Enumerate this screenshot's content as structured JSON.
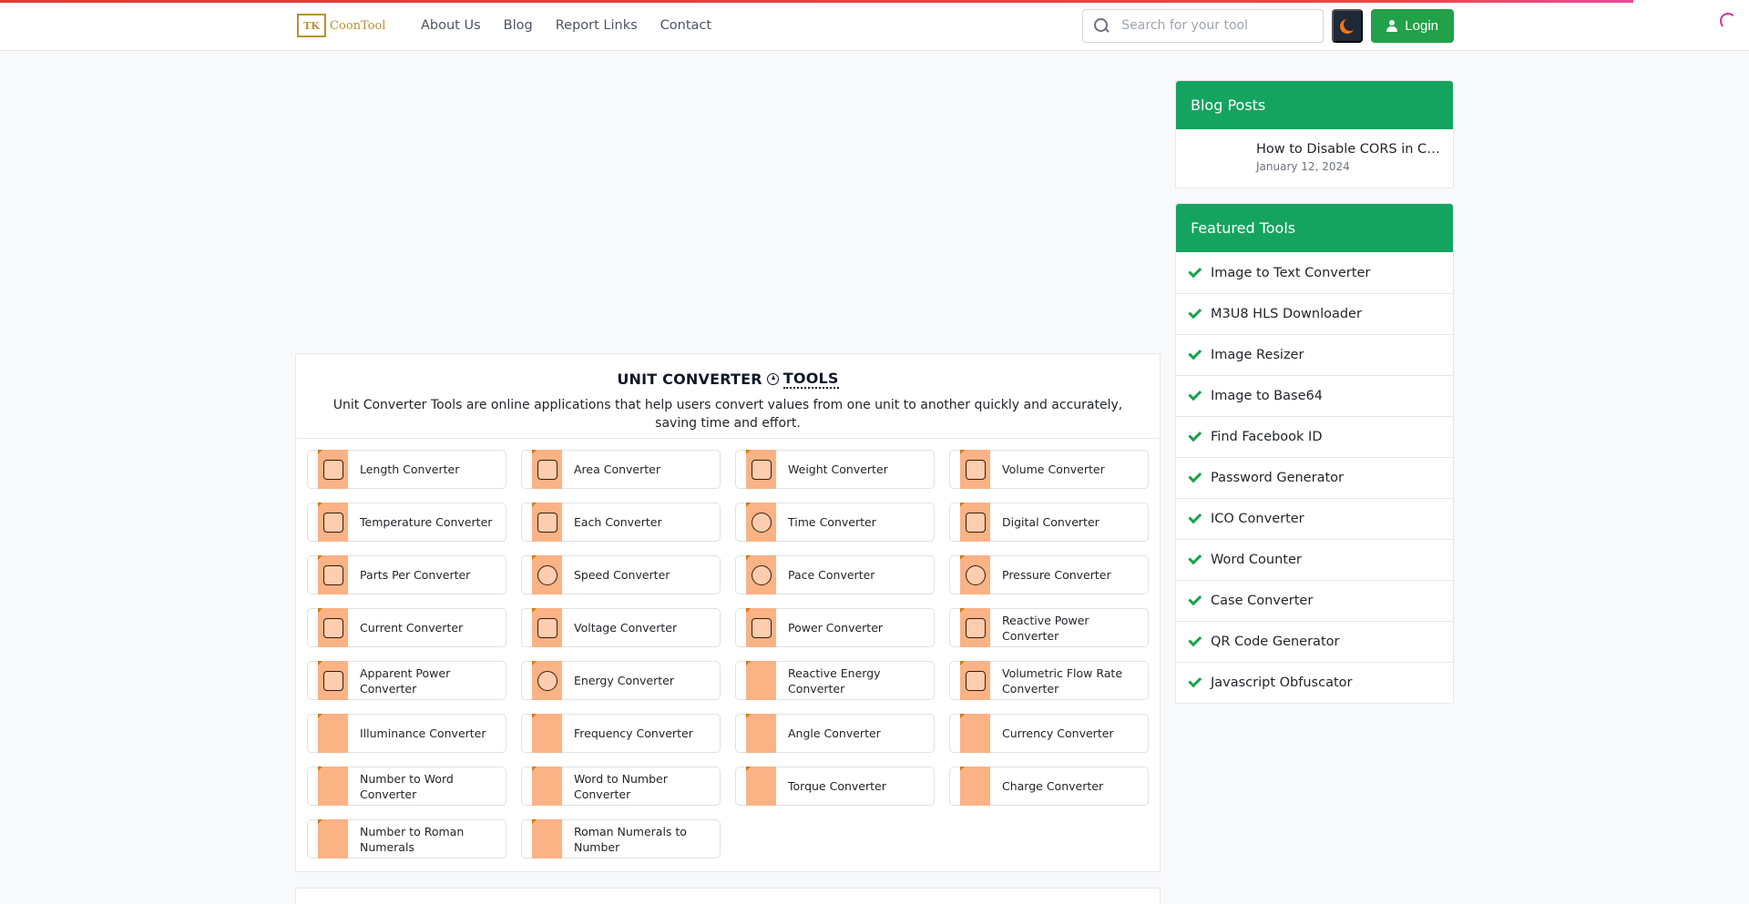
{
  "nav": {
    "logo_mark": "TK",
    "logo_text": "CoonTool",
    "links": [
      "About Us",
      "Blog",
      "Report Links",
      "Contact"
    ],
    "search_placeholder": "Search for your tool",
    "login_label": "Login"
  },
  "colors": {
    "accent_green": "#15a460",
    "login_green": "#22a14a",
    "progress_red": "#ef4444",
    "tool_icon_bg": "#fbb285"
  },
  "tools_section": {
    "title_part1": "UNIT CONVERTER",
    "title_part2": "TOOLS",
    "title_icon": "arrow-circle-up-icon",
    "description": "Unit Converter Tools are online applications that help users convert values from one unit to another quickly and accurately, saving time and effort.",
    "tools": [
      {
        "label": "Length Converter",
        "icon": "tape-measure-icon"
      },
      {
        "label": "Area Converter",
        "icon": "area-icon"
      },
      {
        "label": "Weight Converter",
        "icon": "scale-icon"
      },
      {
        "label": "Volume Converter",
        "icon": "speaker-icon"
      },
      {
        "label": "Temperature Converter",
        "icon": "thermometer-icon"
      },
      {
        "label": "Each Converter",
        "icon": "grid-icon"
      },
      {
        "label": "Time Converter",
        "icon": "clock-icon"
      },
      {
        "label": "Digital Converter",
        "icon": "chip-icon"
      },
      {
        "label": "Parts Per Converter",
        "icon": "parts-icon"
      },
      {
        "label": "Speed Converter",
        "icon": "speedometer-icon"
      },
      {
        "label": "Pace Converter",
        "icon": "stopwatch-icon"
      },
      {
        "label": "Pressure Converter",
        "icon": "gauge-icon"
      },
      {
        "label": "Current Converter",
        "icon": "monitor-icon"
      },
      {
        "label": "Voltage Converter",
        "icon": "voltage-icon"
      },
      {
        "label": "Power Converter",
        "icon": "battery-icon"
      },
      {
        "label": "Reactive Power Converter",
        "icon": "lightning-icon"
      },
      {
        "label": "Apparent Power Converter",
        "icon": "power-tower-icon"
      },
      {
        "label": "Energy Converter",
        "icon": "energy-icon"
      },
      {
        "label": "Reactive Energy Converter",
        "icon": "blank-icon"
      },
      {
        "label": "Volumetric Flow Rate Converter",
        "icon": "barrel-icon"
      },
      {
        "label": "Illuminance Converter",
        "icon": "blank-icon"
      },
      {
        "label": "Frequency Converter",
        "icon": "blank-icon"
      },
      {
        "label": "Angle Converter",
        "icon": "blank-icon"
      },
      {
        "label": "Currency Converter",
        "icon": "blank-icon"
      },
      {
        "label": "Number to Word Converter",
        "icon": "blank-icon"
      },
      {
        "label": "Word to Number Converter",
        "icon": "blank-icon"
      },
      {
        "label": "Torque Converter",
        "icon": "blank-icon"
      },
      {
        "label": "Charge Converter",
        "icon": "blank-icon"
      },
      {
        "label": "Number to Roman Numerals",
        "icon": "blank-icon"
      },
      {
        "label": "Roman Numerals to Number",
        "icon": "blank-icon"
      }
    ]
  },
  "sidebar": {
    "blog_heading": "Blog Posts",
    "blog_posts": [
      {
        "title": "How to Disable CORS in Chro...",
        "date": "January 12, 2024"
      }
    ],
    "featured_heading": "Featured Tools",
    "featured_tools": [
      "Image to Text Converter",
      "M3U8 HLS Downloader",
      "Image Resizer",
      "Image to Base64",
      "Find Facebook ID",
      "Password Generator",
      "ICO Converter",
      "Word Counter",
      "Case Converter",
      "QR Code Generator",
      "Javascript Obfuscator"
    ]
  }
}
